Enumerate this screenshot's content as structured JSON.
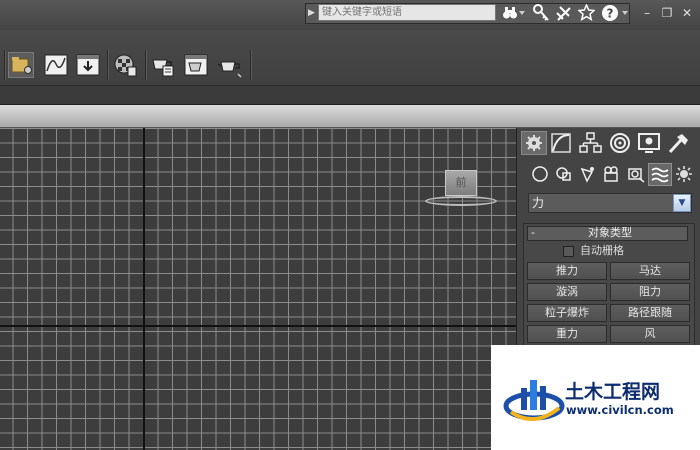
{
  "titlebar": {
    "search_placeholder": "键入关键字或短语",
    "icons": [
      "expand-arrow-icon",
      "binoculars-icon",
      "key-icon",
      "satellite-icon",
      "star-icon",
      "help-icon"
    ],
    "window_controls": {
      "minimize": "–",
      "restore": "❐",
      "close": "✕"
    }
  },
  "toolbar": {
    "icons": [
      "scene-explorer-icon",
      "curve-editor-icon",
      "schematic-view-icon",
      "material-editor-icon",
      "render-setup-icon",
      "rendered-frame-window-icon",
      "render-teapot-icon"
    ]
  },
  "viewport": {
    "gizmo_label": "前",
    "grid_color": "#8b8b8b",
    "background": "#3d3d3d"
  },
  "command_panel": {
    "tabs": [
      "create-tab-icon",
      "modify-tab-icon",
      "hierarchy-tab-icon",
      "motion-tab-icon",
      "display-tab-icon",
      "utilities-tab-icon"
    ],
    "categories": [
      "geometry-icon",
      "shapes-icon",
      "lights-icon",
      "cameras-icon",
      "helpers-icon",
      "space-warps-icon",
      "systems-icon"
    ],
    "dropdown_value": "力",
    "rollout": {
      "toggle": "-",
      "title": "对象类型",
      "autogrid_label": "自动栅格",
      "buttons": [
        "推力",
        "马达",
        "漩涡",
        "阻力",
        "粒子爆炸",
        "路径跟随",
        "重力",
        "风"
      ]
    }
  },
  "watermark": {
    "slogan": "土木工程网",
    "url": "www.civilcn.com"
  }
}
